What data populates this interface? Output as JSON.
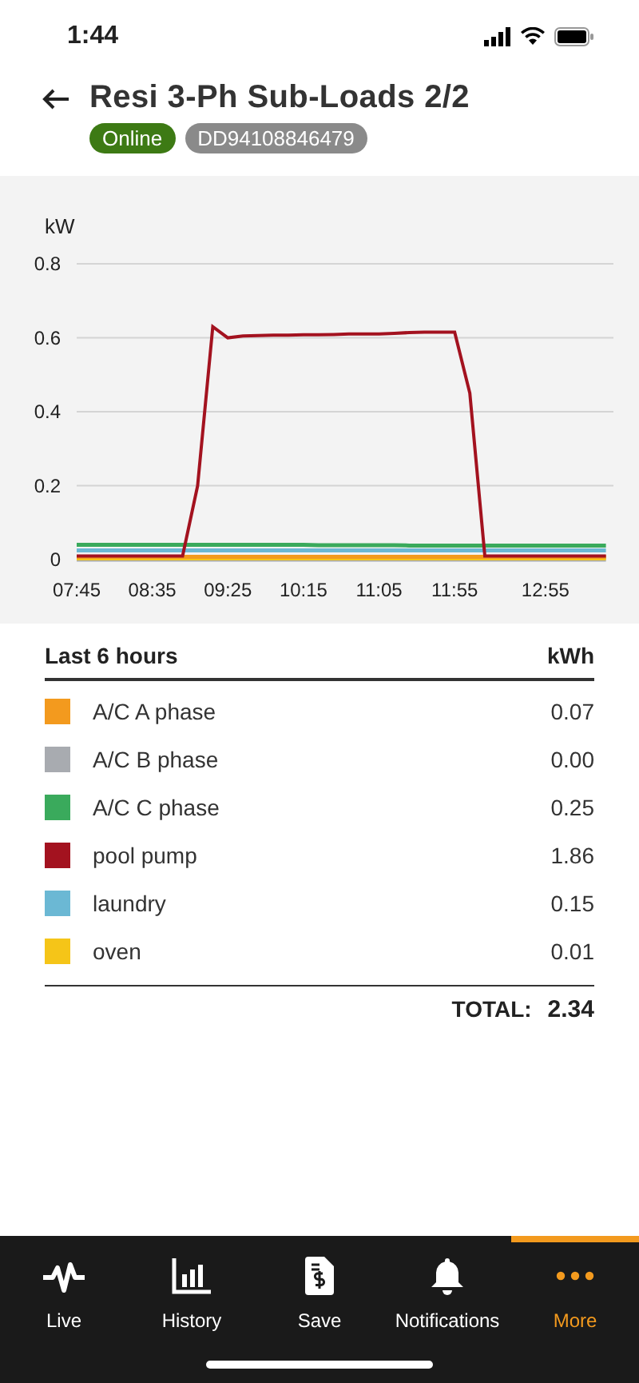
{
  "status_bar": {
    "time": "1:44"
  },
  "header": {
    "title": "Resi 3-Ph Sub-Loads 2/2",
    "badges": [
      {
        "kind": "status",
        "text": "Online"
      },
      {
        "kind": "id",
        "text": "DD94108846479"
      }
    ]
  },
  "chart": {
    "chart_data": {
      "type": "line",
      "ylabel": "kW",
      "categories": [
        "07:45",
        null,
        null,
        null,
        null,
        "08:35",
        null,
        null,
        null,
        null,
        "09:25",
        null,
        null,
        null,
        null,
        "10:15",
        null,
        null,
        null,
        null,
        "11:05",
        null,
        null,
        null,
        null,
        "11:55",
        null,
        null,
        null,
        null,
        null,
        "12:55",
        null,
        null,
        null,
        null
      ],
      "yticks": [
        0,
        {
          "value": 0.2,
          "label": "0.2"
        },
        {
          "value": 0.4,
          "label": "0.4"
        },
        {
          "value": 0.6,
          "label": "0.6"
        },
        {
          "value": 0.8,
          "label": "0.8"
        }
      ],
      "ylim": [
        0,
        0.8
      ],
      "grid": true,
      "series": [
        {
          "color": "#3aaa5c",
          "values": [
            0.04,
            0.04,
            0.04,
            0.04,
            0.04,
            0.04,
            0.04,
            0.04,
            0.04,
            0.04,
            0.04,
            0.04,
            0.04,
            0.04,
            0.04,
            0.04,
            0.039,
            0.039,
            0.039,
            0.039,
            0.039,
            0.039,
            0.038,
            0.038,
            0.038,
            0.038,
            0.038,
            0.038,
            0.038,
            0.038,
            0.038,
            0.038,
            0.038,
            0.038,
            0.038,
            0.038
          ]
        },
        {
          "color": "#6bb8d4",
          "values": [
            0.025,
            0.025,
            0.025,
            0.025,
            0.025,
            0.025,
            0.025,
            0.025,
            0.025,
            0.025,
            0.025,
            0.025,
            0.025,
            0.025,
            0.025,
            0.025,
            0.025,
            0.025,
            0.025,
            0.025,
            0.025,
            0.025,
            0.025,
            0.025,
            0.025,
            0.025,
            0.025,
            0.025,
            0.025,
            0.025,
            0.025,
            0.025,
            0.025,
            0.025,
            0.025,
            0.025
          ]
        },
        {
          "color": "#a8abb0",
          "values": [
            0,
            0,
            0,
            0,
            0,
            0,
            0,
            0,
            0,
            0,
            0,
            0,
            0,
            0,
            0,
            0,
            0,
            0,
            0,
            0,
            0,
            0,
            0,
            0,
            0,
            0,
            0,
            0,
            0,
            0,
            0,
            0,
            0,
            0,
            0,
            0
          ]
        },
        {
          "color": "#f5c518",
          "values": [
            0.003,
            0.003,
            0.003,
            0.003,
            0.003,
            0.003,
            0.003,
            0.003,
            0.003,
            0.003,
            0.003,
            0.003,
            0.003,
            0.003,
            0.003,
            0.003,
            0.003,
            0.003,
            0.003,
            0.003,
            0.003,
            0.003,
            0.003,
            0.003,
            0.003,
            0.003,
            0.003,
            0.003,
            0.003,
            0.003,
            0.003,
            0.003,
            0.003,
            0.003,
            0.003,
            0.003
          ]
        },
        {
          "color": "#f39a1e",
          "values": [
            0.008,
            0.008,
            0.008,
            0.008,
            0.008,
            0.008,
            0.008,
            0.008,
            0.008,
            0.008,
            0.008,
            0.008,
            0.008,
            0.008,
            0.008,
            0.008,
            0.008,
            0.008,
            0.008,
            0.008,
            0.008,
            0.008,
            0.008,
            0.008,
            0.008,
            0.008,
            0.008,
            0.008,
            0.008,
            0.008,
            0.008,
            0.008,
            0.008,
            0.008,
            0.008,
            0.008
          ]
        },
        {
          "color": "#a3121f",
          "values": [
            0.01,
            0.01,
            0.01,
            0.01,
            0.01,
            0.01,
            0.01,
            0.01,
            0.2,
            0.63,
            0.6,
            0.605,
            0.606,
            0.607,
            0.607,
            0.608,
            0.608,
            0.609,
            0.61,
            0.61,
            0.61,
            0.612,
            0.614,
            0.615,
            0.615,
            0.615,
            0.45,
            0.01,
            0.01,
            0.01,
            0.01,
            0.01,
            0.01,
            0.01,
            0.01,
            0.01
          ]
        }
      ]
    }
  },
  "usage": {
    "period": "Last 6 hours",
    "unit": "kWh",
    "rows": [
      {
        "name": "A/C A phase",
        "color": "#f39a1e",
        "value": "0.07"
      },
      {
        "name": "A/C B phase",
        "color": "#a8abb0",
        "value": "0.00"
      },
      {
        "name": "A/C C phase",
        "color": "#3aaa5c",
        "value": "0.25"
      },
      {
        "name": "pool pump",
        "color": "#a3121f",
        "value": "1.86"
      },
      {
        "name": "laundry",
        "color": "#6bb8d4",
        "value": "0.15"
      },
      {
        "name": "oven",
        "color": "#f5c518",
        "value": "0.01"
      }
    ],
    "total_label": "TOTAL:",
    "total": "2.34"
  },
  "nav": {
    "items": [
      {
        "kind": "live",
        "label": "Live",
        "selected": false
      },
      {
        "kind": "history",
        "label": "History",
        "selected": false
      },
      {
        "kind": "save",
        "label": "Save",
        "selected": false
      },
      {
        "kind": "notifications",
        "label": "Notifications",
        "selected": false
      },
      {
        "kind": "more",
        "label": "More",
        "selected": true
      }
    ]
  }
}
